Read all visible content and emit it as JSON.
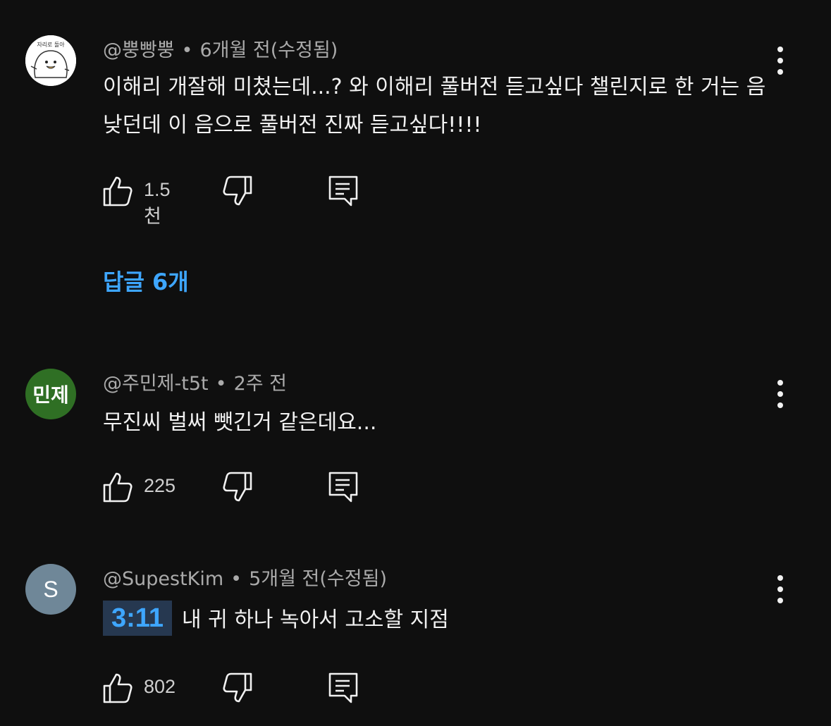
{
  "comments": [
    {
      "author": "@뿡빵뿡",
      "time": "6개월 전(수정됨)",
      "text": "이해리 개잘해 미쳤는데...? 와 이해리 풀버전 듣고싶다 챌린지로 한 거는 음 낮던데 이 음으로 풀버전 진짜 듣고싶다!!!!",
      "likes": "1.5천",
      "avatar_text": "자리로 돌아",
      "avatar_icon": "duck-cartoon-avatar",
      "replies_label": "답글 6개"
    },
    {
      "author": "@주민제-t5t",
      "time": "2주 전",
      "text": "무진씨 벌써 뺏긴거 같은데요...",
      "likes": "225",
      "avatar_text": "민제",
      "avatar_color": "#2f6f24"
    },
    {
      "author": "@SupestKim",
      "time": "5개월 전(수정됨)",
      "timestamp": "3:11",
      "text": "내 귀 하나 녹아서 고소할 지점",
      "likes": "802",
      "avatar_text": "S",
      "avatar_color": "#6f8798"
    }
  ],
  "meta_separator": "•",
  "icons": {
    "like": "thumbs-up-icon",
    "dislike": "thumbs-down-icon",
    "reply": "reply-comment-icon",
    "more": "more-vertical-icon"
  },
  "colors": {
    "background": "#0f0f0f",
    "link": "#3ea6ff",
    "secondary_text": "#aaaaaa"
  }
}
